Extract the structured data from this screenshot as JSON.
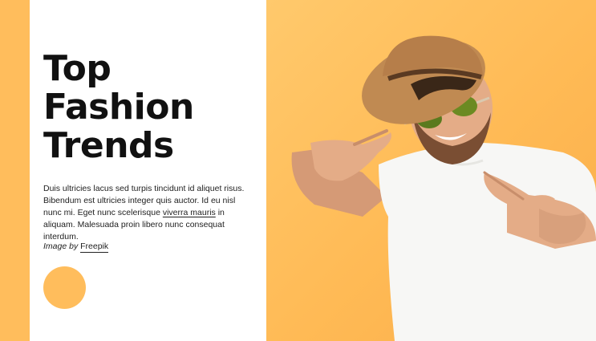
{
  "hero": {
    "headline_lines": [
      "Top",
      "Fashion",
      "Trends"
    ],
    "body_before_link": "Duis ultricies lacus sed turpis tincidunt id aliquet risus. Bibendum est ultricies integer quis auctor. Id eu nisl nunc mi. Eget nunc scelerisque ",
    "body_link": "viverra mauris",
    "body_after_link": " in aliquam. Malesuada proin libero nunc consequat interdum.",
    "credit_prefix": "Image by",
    "credit_link": "Freepik"
  },
  "colors": {
    "accent": "#ffbd5c",
    "card": "#ffffff",
    "text": "#111111"
  },
  "photo": {
    "subject": "man-in-straw-hat-pointing-icon"
  }
}
